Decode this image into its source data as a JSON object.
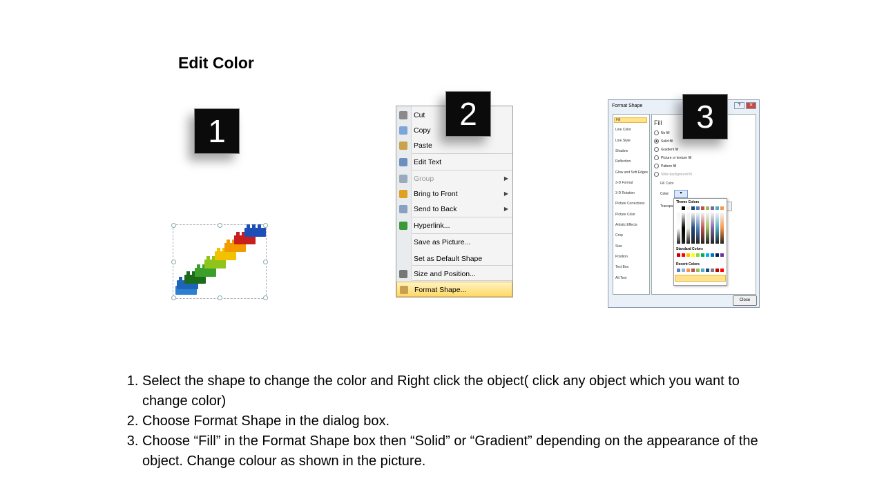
{
  "slide": {
    "title": "Edit Color"
  },
  "badges": [
    "1",
    "2",
    "3"
  ],
  "context_menu": {
    "items": [
      {
        "label": "Cut",
        "icon": "scissors-icon",
        "disabled": false,
        "submenu": false
      },
      {
        "label": "Copy",
        "icon": "copy-icon",
        "disabled": false,
        "submenu": false
      },
      {
        "label": "Paste",
        "icon": "paste-icon",
        "disabled": false,
        "submenu": false
      },
      {
        "label": "Edit Text",
        "icon": "edit-text-icon",
        "disabled": false,
        "submenu": false
      },
      {
        "label": "Group",
        "icon": "group-icon",
        "disabled": true,
        "submenu": true
      },
      {
        "label": "Bring to Front",
        "icon": "bring-front-icon",
        "disabled": false,
        "submenu": true
      },
      {
        "label": "Send to Back",
        "icon": "send-back-icon",
        "disabled": false,
        "submenu": true
      },
      {
        "label": "Hyperlink...",
        "icon": "globe-link-icon",
        "disabled": false,
        "submenu": false
      },
      {
        "label": "Save as Picture...",
        "icon": "",
        "disabled": false,
        "submenu": false
      },
      {
        "label": "Set as Default Shape",
        "icon": "",
        "disabled": false,
        "submenu": false
      },
      {
        "label": "Size and Position...",
        "icon": "size-position-icon",
        "disabled": false,
        "submenu": false
      },
      {
        "label": "Format Shape...",
        "icon": "format-shape-icon",
        "disabled": false,
        "submenu": false,
        "highlighted": true
      }
    ]
  },
  "format_dialog": {
    "title": "Format Shape",
    "help": "?",
    "close_x": "✕",
    "categories": [
      "Fill",
      "Line Color",
      "Line Style",
      "Shadow",
      "Reflection",
      "Glow and Soft Edges",
      "3-D Format",
      "3-D Rotation",
      "Picture Corrections",
      "Picture Color",
      "Artistic Effects",
      "Crop",
      "Size",
      "Position",
      "Text Box",
      "Alt Text"
    ],
    "section": "Fill",
    "options": [
      "No fill",
      "Solid fill",
      "Gradient fill",
      "Picture or texture fill",
      "Pattern fill",
      "Slide background fill"
    ],
    "selected_option": "Solid fill",
    "fill_color_label": "Fill Color",
    "color_label": "Color:",
    "transparency_label": "Transpa",
    "palette": {
      "theme_label": "Theme Colors",
      "standard_label": "Standard Colors",
      "recent_label": "Recent Colors"
    },
    "close_button": "Close"
  },
  "instructions": [
    "Select the shape to change the color and Right click the object( click any object which you want to change color)",
    "Choose Format Shape in the dialog box.",
    "Choose “Fill” in the Format Shape box then “Solid” or “Gradient” depending on the appearance of the object. Change colour as shown in the picture."
  ],
  "colors": {
    "badge_bg": "#0b0b0b",
    "highlight": "#ffd966",
    "bricks": [
      "#2f7fd0",
      "#1b6b1b",
      "#3aa02a",
      "#8fc41a",
      "#f2c200",
      "#f29a00",
      "#e06a00",
      "#c81e1e",
      "#1d4fb8"
    ],
    "theme_row": [
      "#ffffff",
      "#000000",
      "#eeece1",
      "#1f497d",
      "#4f81bd",
      "#c0504d",
      "#9bbb59",
      "#8064a2",
      "#4bacc6",
      "#f79646"
    ],
    "standard_row": [
      "#c00000",
      "#ff0000",
      "#ffc000",
      "#ffff00",
      "#92d050",
      "#00b050",
      "#00b0f0",
      "#0070c0",
      "#002060",
      "#7030a0"
    ],
    "recent_row": [
      "#4f81bd",
      "#8db3e2",
      "#f79646",
      "#c0504d",
      "#9bbb59",
      "#4bacc6",
      "#1f497d",
      "#7f7f7f",
      "#c00000",
      "#ff0000"
    ]
  }
}
